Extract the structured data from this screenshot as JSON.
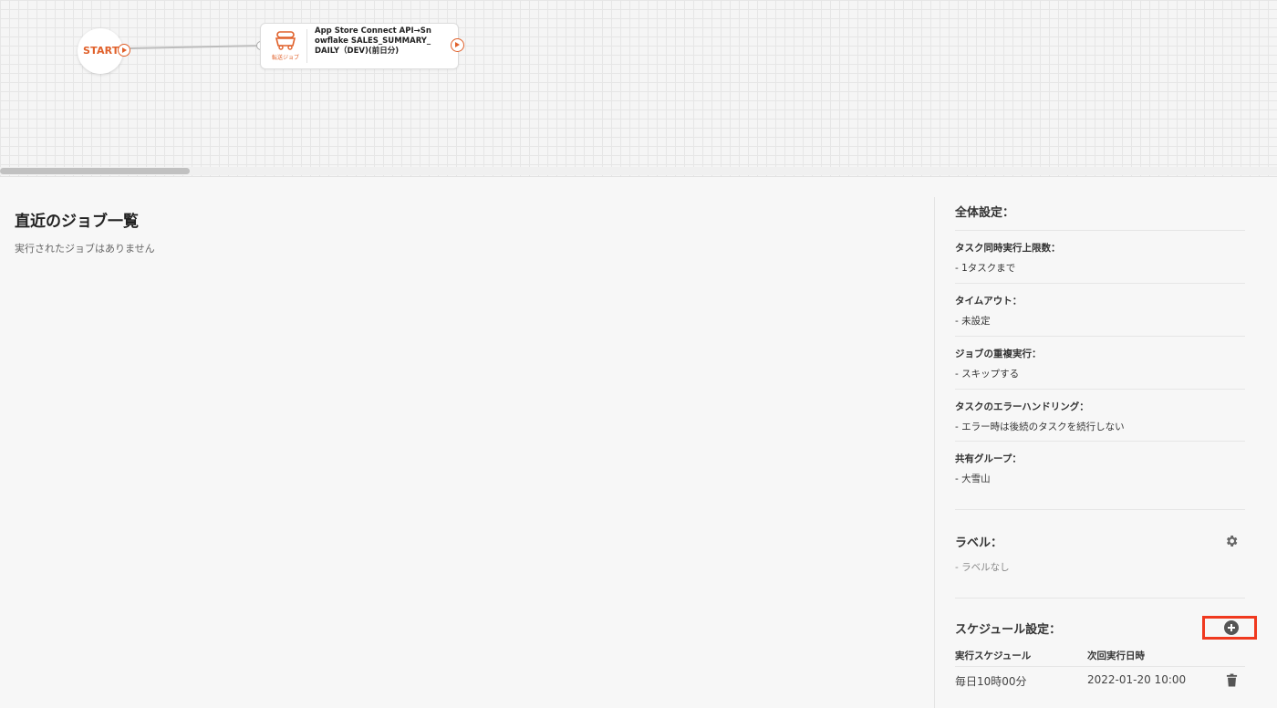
{
  "canvas": {
    "start_label": "START",
    "job_node": {
      "type_label": "転送ジョブ",
      "title": "App Store Connect API→Snowflake SALES_SUMMARY_DAILY（DEV)(前日分)"
    }
  },
  "recent_jobs": {
    "title": "直近のジョブ一覧",
    "empty_message": "実行されたジョブはありません"
  },
  "overall_settings": {
    "title": "全体設定：",
    "items": [
      {
        "label": "タスク同時実行上限数：",
        "value": "- 1タスクまで"
      },
      {
        "label": "タイムアウト：",
        "value": "- 未設定"
      },
      {
        "label": "ジョブの重複実行：",
        "value": "- スキップする"
      },
      {
        "label": "タスクのエラーハンドリング：",
        "value": "- エラー時は後続のタスクを続行しない"
      },
      {
        "label": "共有グループ：",
        "value": "- 大雪山"
      }
    ]
  },
  "labels": {
    "title": "ラベル：",
    "value": "- ラベルなし"
  },
  "schedule": {
    "title": "スケジュール設定：",
    "columns": [
      "実行スケジュール",
      "次回実行日時"
    ],
    "rows": [
      {
        "schedule": "毎日10時00分",
        "next_run": "2022-01-20 10:00"
      }
    ]
  },
  "icons": [
    "play-icon",
    "truck-icon",
    "gear-icon",
    "plus-circle-icon",
    "trash-icon"
  ],
  "colors": {
    "accent": "#e0602a",
    "highlight": "#f0391f"
  }
}
